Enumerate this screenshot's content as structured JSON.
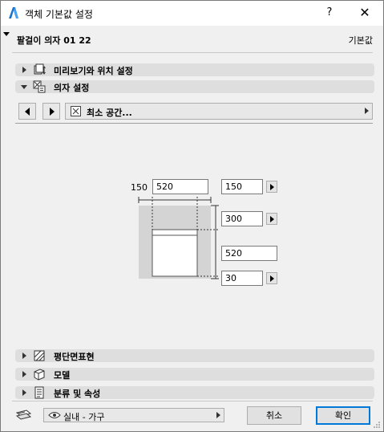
{
  "window": {
    "title": "객체 기본값 설정",
    "help_label": "?",
    "close_label": "✕",
    "icon": "archicad-icon"
  },
  "header": {
    "object_name": "팔걸이 의자 01 22",
    "default_label": "기본값"
  },
  "panels": {
    "preview": {
      "label": "미리보기와 위치 설정",
      "icon": "preview-position-icon",
      "expanded": false
    },
    "chair": {
      "label": "의자 설정",
      "icon": "chair-settings-icon",
      "expanded": true
    },
    "floor_plan": {
      "label": "평단면표현",
      "icon": "floor-plan-icon",
      "expanded": false
    },
    "model": {
      "label": "모델",
      "icon": "model-cube-icon",
      "expanded": false
    },
    "classification": {
      "label": "분류 및 속성",
      "icon": "classification-icon",
      "expanded": false
    }
  },
  "page_nav": {
    "prev_icon": "prev-page-icon",
    "next_icon": "next-page-icon",
    "current_page": "최소 공간...",
    "page_icon": "min-space-icon"
  },
  "clearance": {
    "left_label": "150",
    "width_value": "520",
    "right_value": "150",
    "back_value": "300",
    "depth_value": "520",
    "front_value": "30"
  },
  "footer": {
    "layer_icon": "layer-icon",
    "layer_value": "실내 - 가구",
    "cancel_label": "취소",
    "ok_label": "확인"
  },
  "colors": {
    "window_bg": "#f0f0f0",
    "panel_header": "#dedede",
    "accent": "#0078d7",
    "clearance_zone": "#d4d4d4"
  }
}
